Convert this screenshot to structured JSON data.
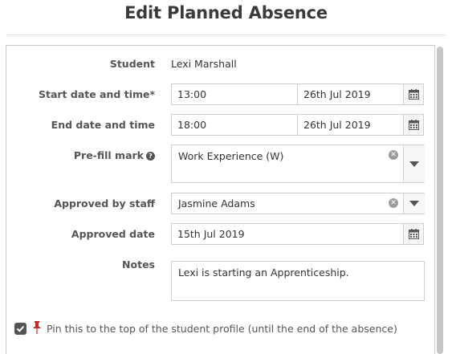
{
  "page": {
    "title": "Edit Planned Absence"
  },
  "form": {
    "student": {
      "label": "Student",
      "value": "Lexi Marshall"
    },
    "start": {
      "label": "Start date and time*",
      "time": "13:00",
      "date": "26th Jul 2019"
    },
    "end": {
      "label": "End date and time",
      "time": "18:00",
      "date": "26th Jul 2019"
    },
    "prefill": {
      "label": "Pre-fill mark",
      "value": "Work Experience (W)"
    },
    "approved_by": {
      "label": "Approved by staff",
      "value": "Jasmine Adams"
    },
    "approved_date": {
      "label": "Approved date",
      "value": "15th Jul 2019"
    },
    "notes": {
      "label": "Notes",
      "value": "Lexi is starting an Apprenticeship."
    },
    "pin": {
      "label": "Pin this to the top of the student profile (until the end of the absence)",
      "checked": true
    }
  },
  "icons": {
    "calendar": "calendar-icon",
    "help": "question-circle-icon",
    "clear": "times-circle-icon",
    "caret": "caret-down-icon",
    "pin": "thumbtack-icon",
    "check": "check-icon"
  },
  "colors": {
    "pin": "#c62828",
    "checkbox": "#555555",
    "label": "#555555"
  }
}
